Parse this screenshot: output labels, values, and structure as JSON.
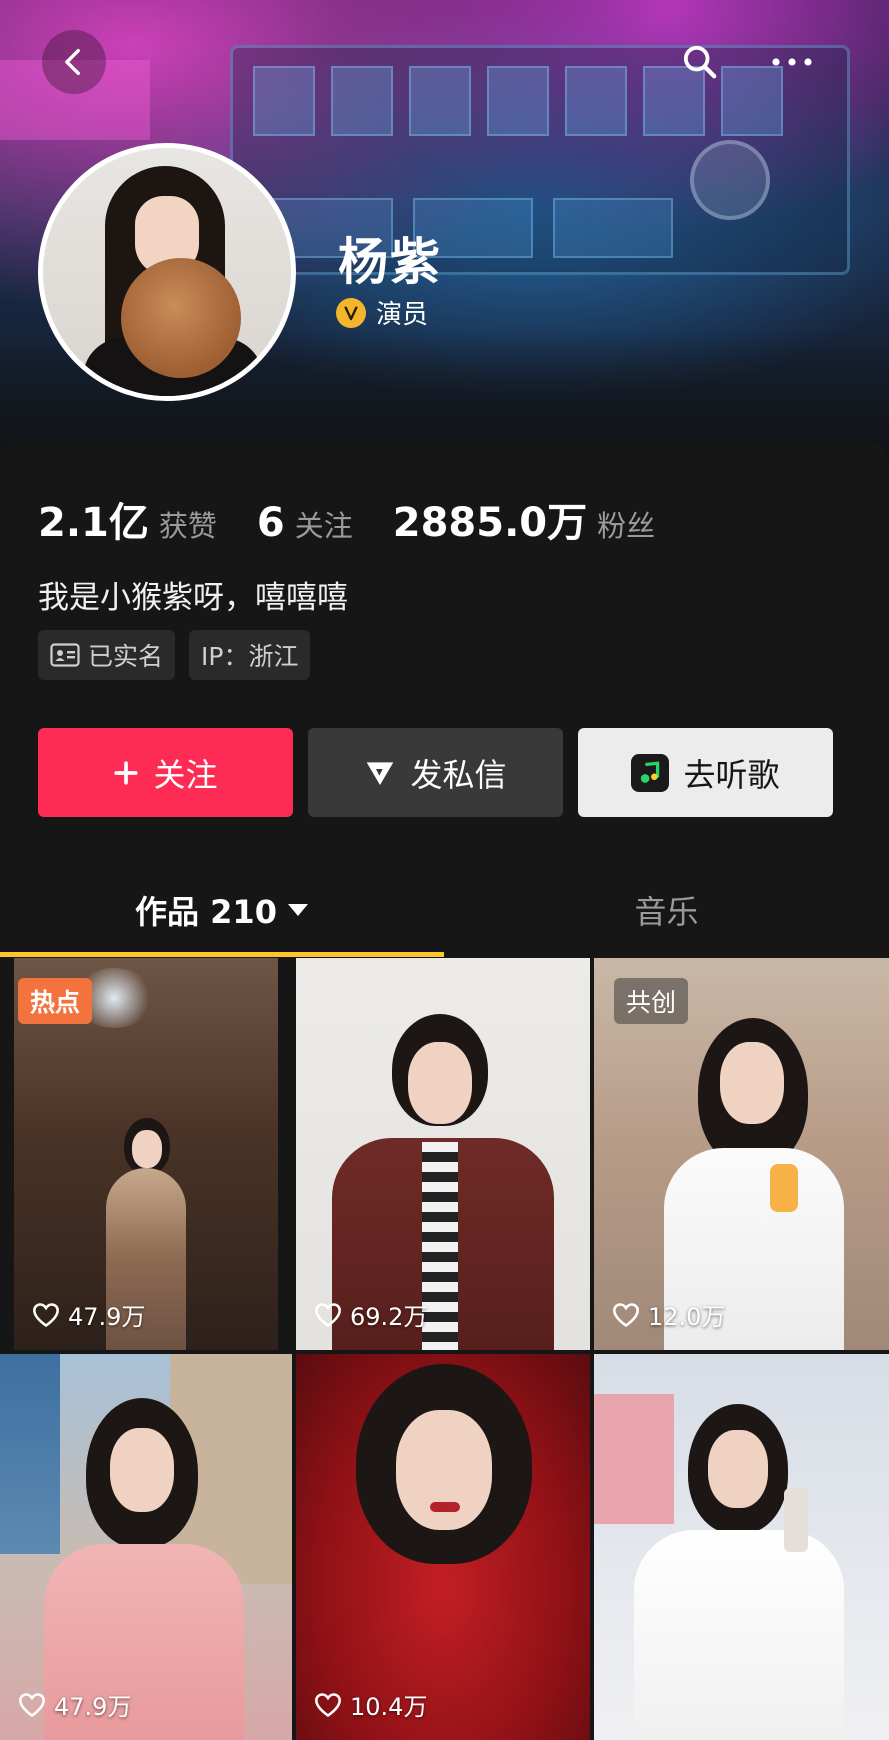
{
  "header": {
    "name": "杨紫",
    "verification": "演员"
  },
  "stats": {
    "likes_value": "2.1亿",
    "likes_label": "获赞",
    "following_value": "6",
    "following_label": "关注",
    "followers_value": "2885.0万",
    "followers_label": "粉丝"
  },
  "bio": "我是小猴紫呀，嘻嘻嘻",
  "tags": {
    "realname": "已实名",
    "ip": "IP：浙江"
  },
  "actions": {
    "follow": "关注",
    "message": "发私信",
    "music": "去听歌"
  },
  "tabs": {
    "works": "作品 210",
    "music": "音乐"
  },
  "videos": [
    {
      "likes": "47.9万",
      "badge": "热点"
    },
    {
      "likes": "69.2万",
      "badge": ""
    },
    {
      "likes": "12.0万",
      "badge": "共创"
    },
    {
      "likes": "47.9万",
      "badge": ""
    },
    {
      "likes": "10.4万",
      "badge": ""
    },
    {
      "likes": "",
      "badge": ""
    }
  ],
  "colors": {
    "follow_button": "#fe2c55",
    "tab_indicator": "#fec62d",
    "hot_badge": "#f3733e",
    "verify_badge": "#f3b52b"
  }
}
